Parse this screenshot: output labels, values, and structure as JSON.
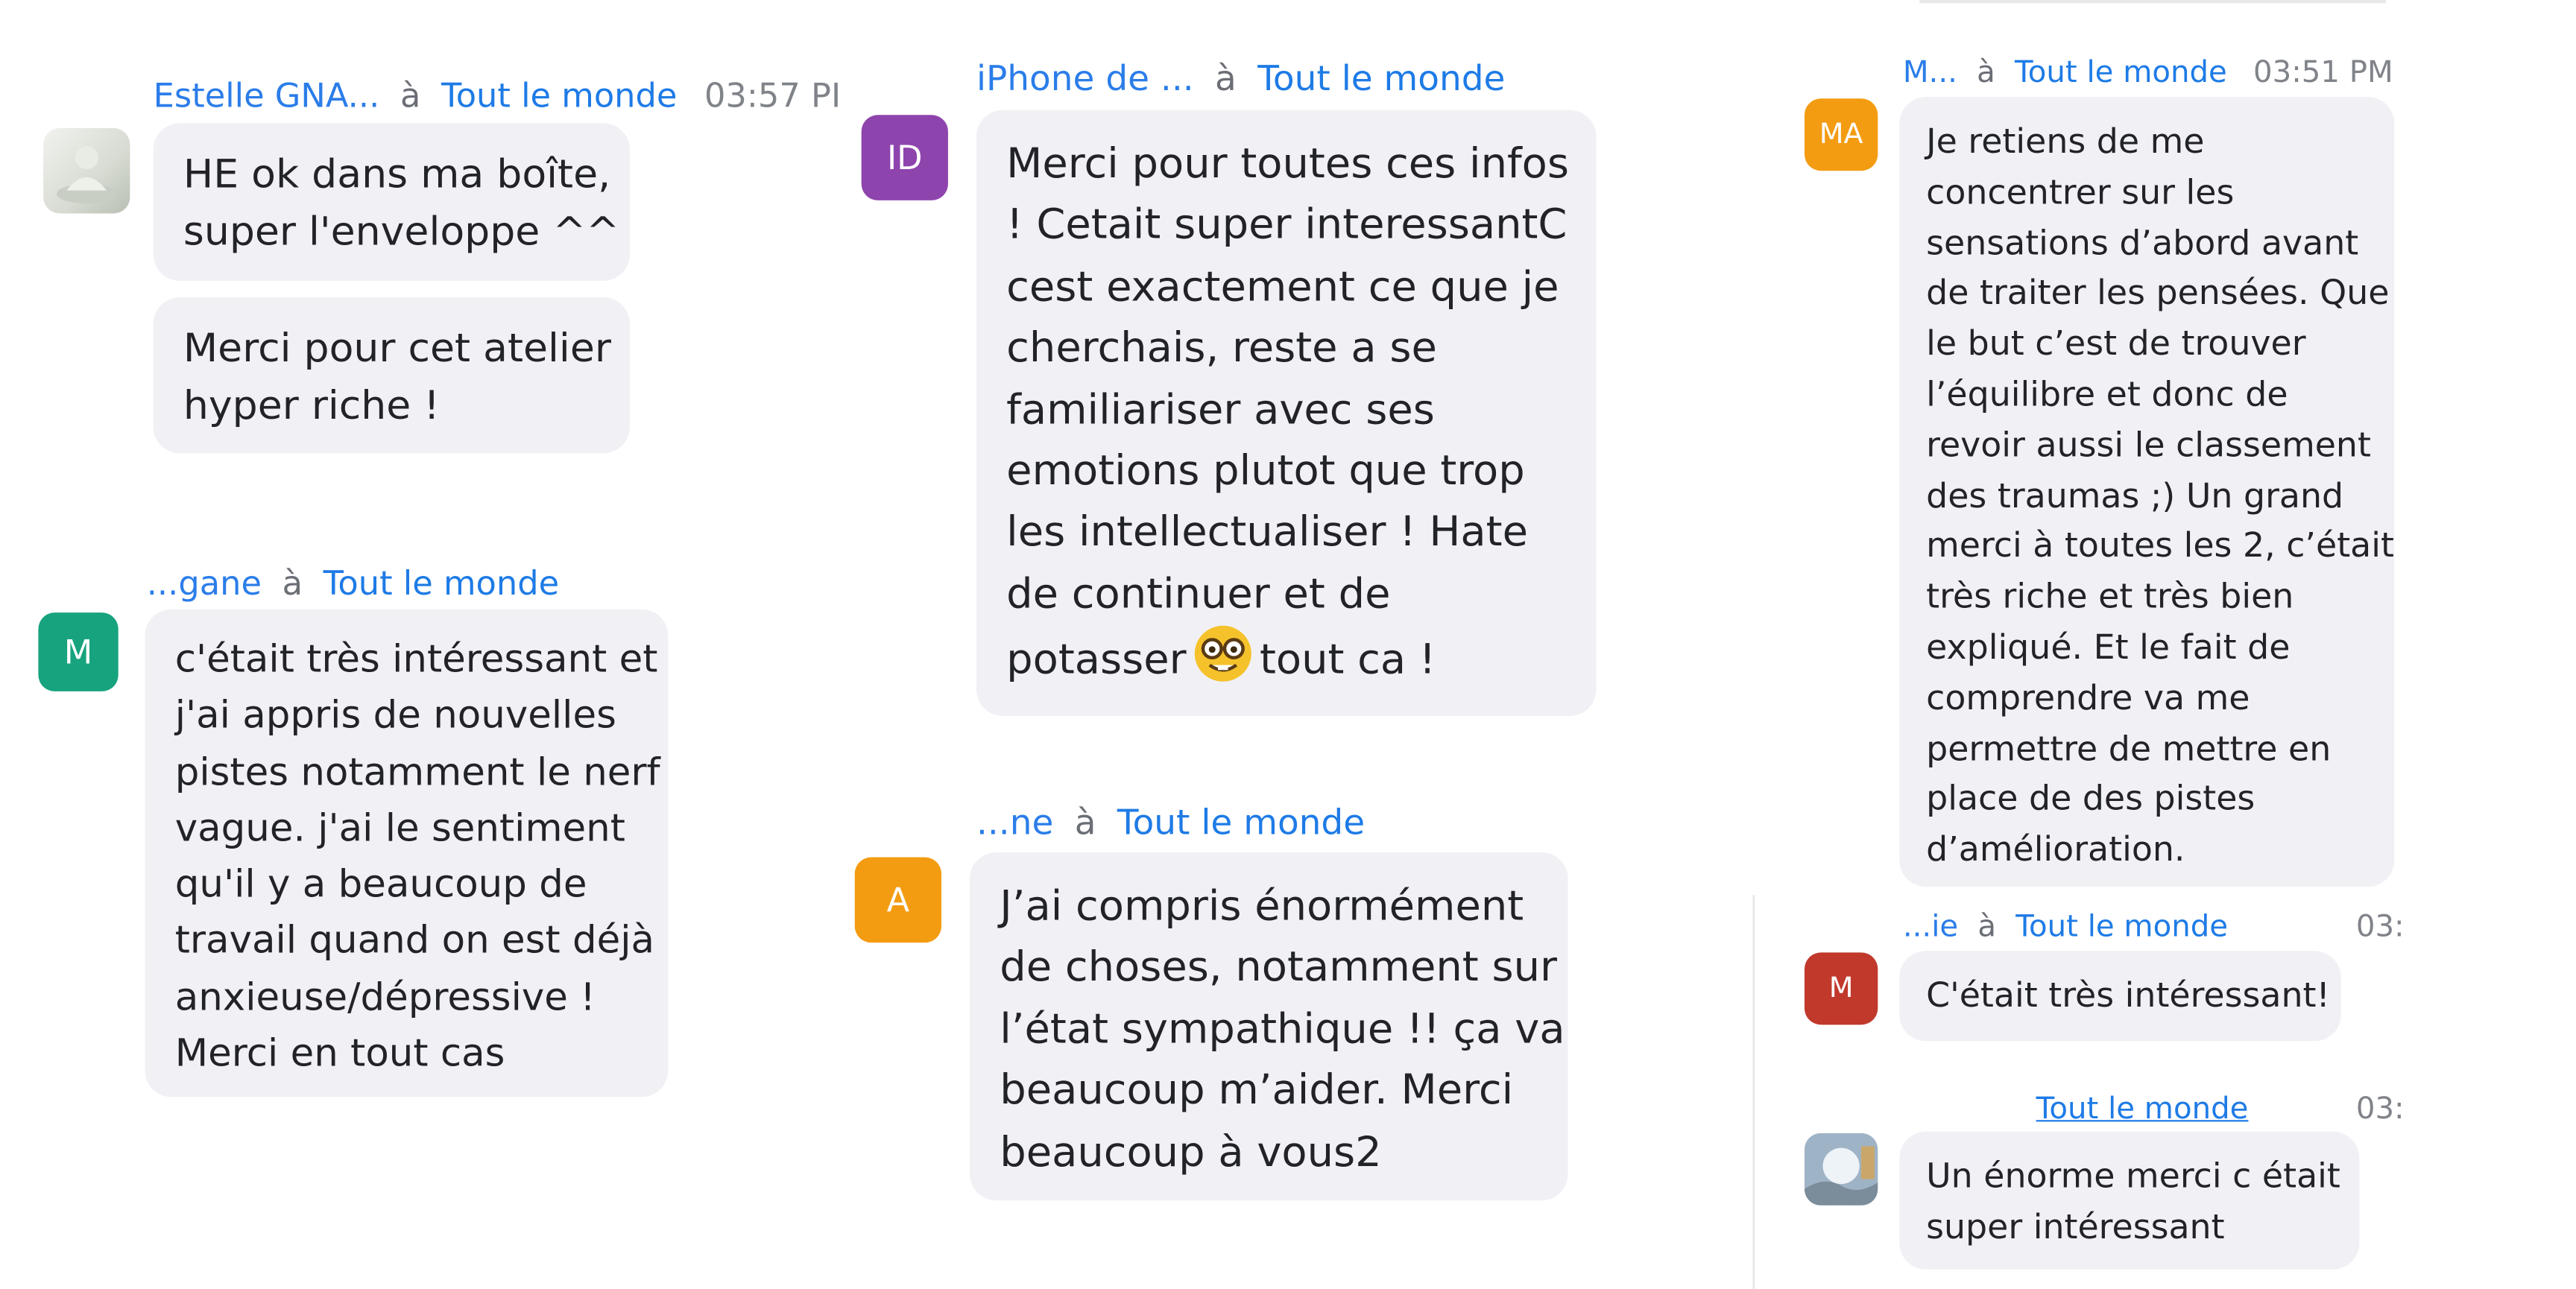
{
  "messages": [
    {
      "sender": "Estelle GNA...",
      "to": "à",
      "recipient": "Tout le monde",
      "time": "03:57 PI",
      "avatar": {
        "kind": "photo"
      },
      "bubbles": [
        {
          "lines": [
            "HE ok dans ma boîte,",
            "super l'enveloppe ^^"
          ]
        },
        {
          "lines": [
            "Merci pour cet atelier",
            "hyper riche !"
          ]
        }
      ]
    },
    {
      "sender": "...gane",
      "to": "à",
      "recipient": "Tout le monde",
      "avatar": {
        "kind": "initials",
        "initials": "M",
        "color": "#17a37e"
      },
      "bubbles": [
        {
          "lines": [
            "c'était très intéressant et",
            "j'ai appris de nouvelles",
            "pistes notamment le nerf",
            "vague. j'ai le sentiment",
            "qu'il y a beaucoup de",
            "travail quand on est déjà",
            "anxieuse/dépressive !",
            "Merci en tout cas"
          ]
        }
      ]
    },
    {
      "sender": "iPhone de ...",
      "to": "à",
      "recipient": "Tout le monde",
      "avatar": {
        "kind": "initials",
        "initials": "ID",
        "color": "#8e44ad"
      },
      "bubbles": [
        {
          "lines": [
            "Merci pour toutes ces infos",
            "! Cetait super interessantC",
            "cest exactement ce que je",
            "cherchais, reste a se",
            "familiariser avec ses",
            "emotions plutot que trop",
            "les intellectualiser ! Hate",
            "de continuer et de",
            "potasser",
            "tout ca !"
          ],
          "emoji": "nerd-face-emoji"
        }
      ]
    },
    {
      "sender": "...ne",
      "to": "à",
      "recipient": "Tout le monde",
      "avatar": {
        "kind": "initials",
        "initials": "A",
        "color": "#f39c12"
      },
      "bubbles": [
        {
          "lines": [
            "J’ai compris énormément",
            "de choses, notamment sur",
            "l’état sympathique !! ça va",
            "beaucoup m’aider. Merci",
            "beaucoup à vous2"
          ]
        }
      ]
    },
    {
      "sender": "M...",
      "to": "à",
      "recipient": "Tout le monde",
      "time": "03:51 PM",
      "avatar": {
        "kind": "initials",
        "initials": "MA",
        "color": "#f39c12"
      },
      "bubbles": [
        {
          "lines": [
            "Je retiens de me",
            "concentrer sur les",
            "sensations d’abord avant",
            "de traiter les pensées. Que",
            "le but c’est de trouver",
            "l’équilibre et donc de",
            "revoir aussi le classement",
            "des traumas ;) Un grand",
            "merci à toutes les 2, c’était",
            "très riche et très bien",
            "expliqué. Et le fait de",
            "comprendre va me",
            "permettre de mettre en",
            "place de des pistes",
            "d’amélioration."
          ]
        }
      ]
    },
    {
      "sender": "...ie",
      "to": "à",
      "recipient": "Tout le monde",
      "time": "03:",
      "avatar": {
        "kind": "initials",
        "initials": "M",
        "color": "#c0392b"
      },
      "bubbles": [
        {
          "lines": [
            "C'était très intéressant!"
          ]
        }
      ]
    },
    {
      "sender": "",
      "to": "",
      "recipient": "Tout le monde",
      "time": "03:",
      "avatar": {
        "kind": "photo2"
      },
      "bubbles": [
        {
          "lines": [
            "Un énorme merci c était",
            "super intéressant"
          ]
        }
      ]
    }
  ]
}
